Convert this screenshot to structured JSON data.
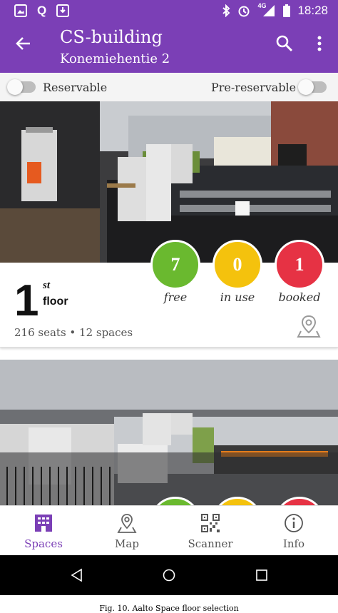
{
  "status_bar": {
    "time": "18:28",
    "network": "4G",
    "left_icons": [
      "image-icon",
      "q-app-icon",
      "download-icon"
    ],
    "right_icons": [
      "bluetooth-icon",
      "alarm-icon",
      "signal-icon",
      "battery-icon"
    ]
  },
  "app_bar": {
    "title": "CS-building",
    "subtitle": "Konemiehentie 2",
    "background": "#7b3fb6"
  },
  "filters": {
    "reservable_label": "Reservable",
    "pre_reservable_label": "Pre-reservable"
  },
  "floors": [
    {
      "number": "1",
      "suffix": "st",
      "word": "floor",
      "seats_text": "216 seats • 12 spaces",
      "stats": [
        {
          "value": "7",
          "label": "free",
          "color": "#6ab92f"
        },
        {
          "value": "0",
          "label": "in use",
          "color": "#f4c20d"
        },
        {
          "value": "1",
          "label": "booked",
          "color": "#e63244"
        }
      ]
    }
  ],
  "next_floor_stat_colors": [
    "#6ab92f",
    "#f4c20d",
    "#e63244"
  ],
  "bottom_nav": [
    {
      "label": "Spaces",
      "icon": "building-icon",
      "active": true
    },
    {
      "label": "Map",
      "icon": "map-pin-icon",
      "active": false
    },
    {
      "label": "Scanner",
      "icon": "qr-code-icon",
      "active": false
    },
    {
      "label": "Info",
      "icon": "info-icon",
      "active": false
    }
  ],
  "caption": "Fig. 10. Aalto Space floor selection"
}
